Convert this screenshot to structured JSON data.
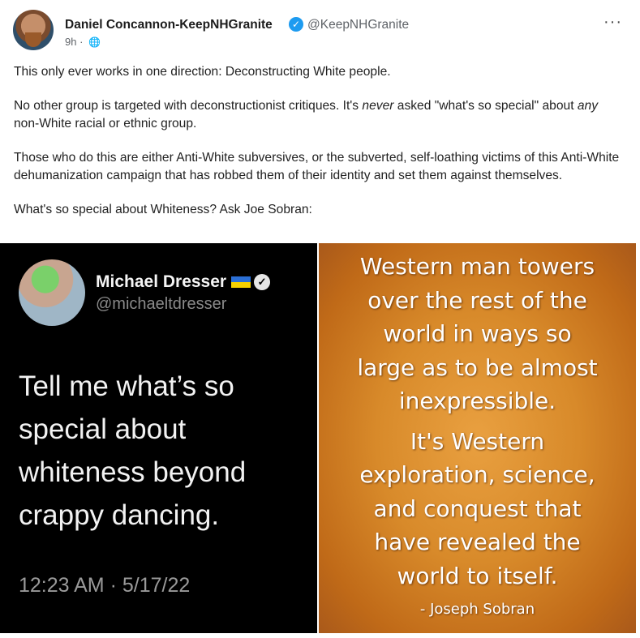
{
  "post": {
    "author_name": "Daniel Concannon-KeepNHGranite",
    "handle": "@KeepNHGranite",
    "timestamp": "9h",
    "visibility_icon": "globe-icon",
    "more_icon": "more-options-icon",
    "paragraphs": [
      "This only ever works in one direction: Deconstructing White people.",
      "No other group is targeted with deconstructionist critiques. It's never asked \"what's so special\" about any non-White racial or ethnic group.",
      "Those who do this are either Anti-White subversives, or the subverted, self-loathing victims of this Anti-White dehumanization campaign that has robbed them of their identity and set them against themselves.",
      "What's so special about Whiteness? Ask Joe Sobran:"
    ]
  },
  "left_image": {
    "name": "Michael Dresser",
    "handle": "@michaeltdresser",
    "tweet_text": "Tell me what’s so special about whiteness beyond crappy dancing.",
    "time": "12:23 AM · 5/17/22"
  },
  "right_image": {
    "quote_lines_1": [
      "Western man towers",
      "over the rest of the",
      "world in ways so",
      "large as to be almost",
      "inexpressible."
    ],
    "quote_lines_2": [
      "It's Western",
      "exploration, science,",
      "and conquest that",
      "have revealed the",
      "world to itself."
    ],
    "attribution": "- Joseph Sobran"
  },
  "colors": {
    "verified": "#1d9bf0",
    "left_bg": "#000000",
    "right_bg": "#d88a2a"
  }
}
